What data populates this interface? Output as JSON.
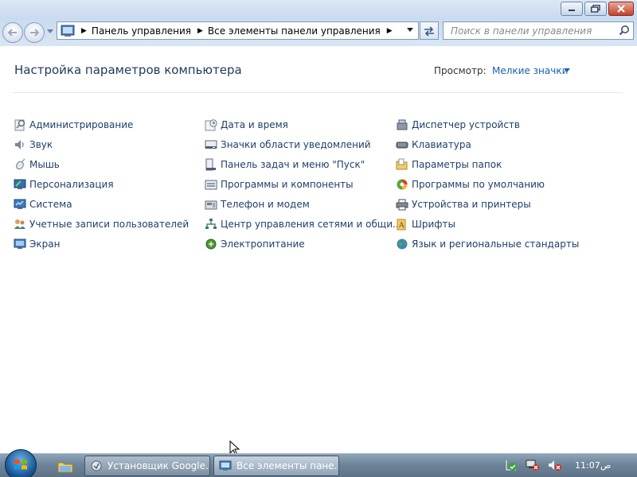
{
  "window": {
    "address_segments": [
      "Панель управления",
      "Все элементы панели управления"
    ],
    "search_placeholder": "Поиск в панели управления"
  },
  "header": {
    "title": "Настройка параметров компьютера",
    "view_label": "Просмотр:",
    "view_value": "Мелкие значки"
  },
  "columns": [
    [
      {
        "label": "Администрирование",
        "icon": "admin-tools-icon"
      },
      {
        "label": "Звук",
        "icon": "sound-icon"
      },
      {
        "label": "Мышь",
        "icon": "mouse-icon"
      },
      {
        "label": "Персонализация",
        "icon": "personalization-icon"
      },
      {
        "label": "Система",
        "icon": "system-icon"
      },
      {
        "label": "Учетные записи пользователей",
        "icon": "user-accounts-icon"
      },
      {
        "label": "Экран",
        "icon": "display-icon"
      }
    ],
    [
      {
        "label": "Дата и время",
        "icon": "date-time-icon"
      },
      {
        "label": "Значки области уведомлений",
        "icon": "notification-icons-icon"
      },
      {
        "label": "Панель задач и меню \"Пуск\"",
        "icon": "taskbar-start-icon"
      },
      {
        "label": "Программы и компоненты",
        "icon": "programs-features-icon"
      },
      {
        "label": "Телефон и модем",
        "icon": "phone-modem-icon"
      },
      {
        "label": "Центр управления сетями и общи...",
        "icon": "network-center-icon"
      },
      {
        "label": "Электропитание",
        "icon": "power-options-icon"
      }
    ],
    [
      {
        "label": "Диспетчер устройств",
        "icon": "device-manager-icon"
      },
      {
        "label": "Клавиатура",
        "icon": "keyboard-icon"
      },
      {
        "label": "Параметры папок",
        "icon": "folder-options-icon"
      },
      {
        "label": "Программы по умолчанию",
        "icon": "default-programs-icon"
      },
      {
        "label": "Устройства и принтеры",
        "icon": "devices-printers-icon"
      },
      {
        "label": "Шрифты",
        "icon": "fonts-icon"
      },
      {
        "label": "Язык и региональные стандарты",
        "icon": "region-language-icon"
      }
    ]
  ],
  "taskbar": {
    "tasks": [
      {
        "label": "Установщик Google...",
        "icon": "installer-icon"
      },
      {
        "label": "Все элементы пане...",
        "icon": "control-panel-icon"
      }
    ],
    "time": "11:07",
    "ampm": "ص"
  },
  "colors": {
    "link": "#1e3f6b",
    "view_link": "#1a5fb4",
    "title": "#1e395b"
  }
}
